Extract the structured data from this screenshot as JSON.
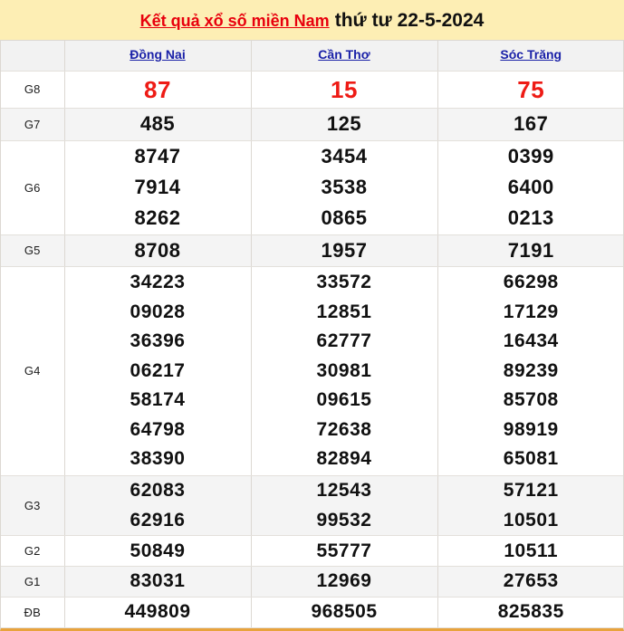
{
  "banner": {
    "link_text": "Kết quả xổ số miền Nam",
    "date_text": "thứ tư 22-5-2024",
    "background_color": "#fdeeb4",
    "link_color": "#e8000d",
    "date_color": "#111111"
  },
  "table": {
    "corner_label": "",
    "columns": [
      {
        "label": "Đồng Nai"
      },
      {
        "label": "Cần Thơ"
      },
      {
        "label": "Sóc Trăng"
      }
    ],
    "header_link_color": "#1a21a8",
    "highlight_color": "#ee1b15",
    "rows": [
      {
        "label": "G8",
        "shade": "plain",
        "values": [
          [
            "87"
          ],
          [
            "15"
          ],
          [
            "75"
          ]
        ]
      },
      {
        "label": "G7",
        "shade": "alt",
        "values": [
          [
            "485"
          ],
          [
            "125"
          ],
          [
            "167"
          ]
        ]
      },
      {
        "label": "G6",
        "shade": "plain",
        "values": [
          [
            "8747",
            "7914",
            "8262"
          ],
          [
            "3454",
            "3538",
            "0865"
          ],
          [
            "0399",
            "6400",
            "0213"
          ]
        ]
      },
      {
        "label": "G5",
        "shade": "alt",
        "values": [
          [
            "8708"
          ],
          [
            "1957"
          ],
          [
            "7191"
          ]
        ]
      },
      {
        "label": "G4",
        "shade": "plain",
        "values": [
          [
            "34223",
            "09028",
            "36396",
            "06217",
            "58174",
            "64798",
            "38390"
          ],
          [
            "33572",
            "12851",
            "62777",
            "30981",
            "09615",
            "72638",
            "82894"
          ],
          [
            "66298",
            "17129",
            "16434",
            "89239",
            "85708",
            "98919",
            "65081"
          ]
        ]
      },
      {
        "label": "G3",
        "shade": "alt",
        "values": [
          [
            "62083",
            "62916"
          ],
          [
            "12543",
            "99532"
          ],
          [
            "57121",
            "10501"
          ]
        ]
      },
      {
        "label": "G2",
        "shade": "plain",
        "values": [
          [
            "50849"
          ],
          [
            "55777"
          ],
          [
            "10511"
          ]
        ]
      },
      {
        "label": "G1",
        "shade": "alt",
        "values": [
          [
            "83031"
          ],
          [
            "12969"
          ],
          [
            "27653"
          ]
        ]
      },
      {
        "label": "ĐB",
        "shade": "plain",
        "values": [
          [
            "449809"
          ],
          [
            "968505"
          ],
          [
            "825835"
          ]
        ]
      }
    ]
  }
}
